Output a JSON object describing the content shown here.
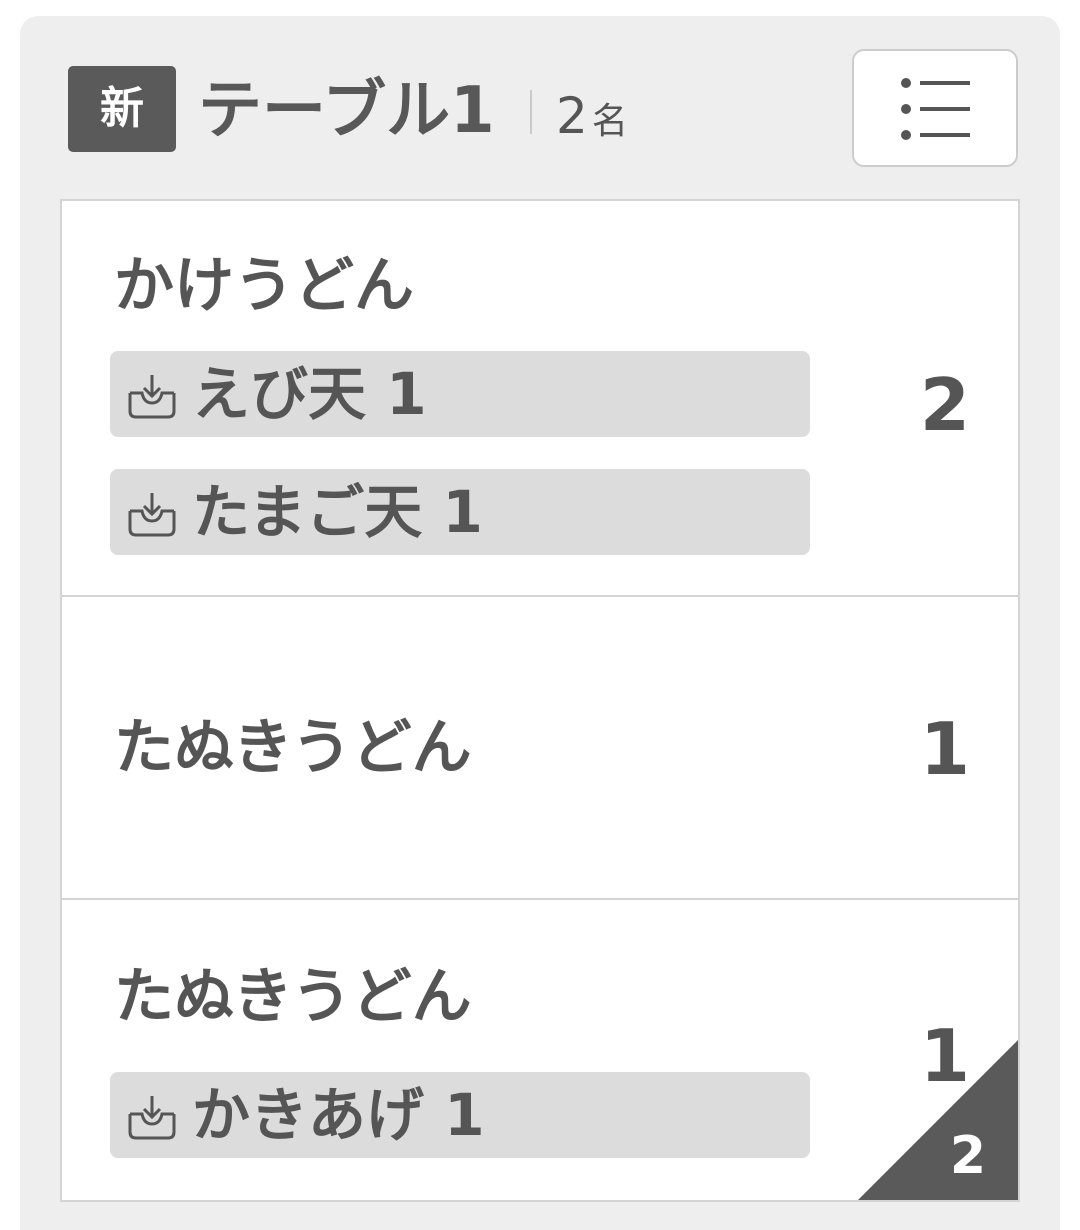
{
  "header": {
    "new_badge": "新",
    "table_name": "テーブル1",
    "guest_count": "2",
    "guest_unit": "名",
    "menu_icon": "list-icon"
  },
  "orders": [
    {
      "name": "かけうどん",
      "quantity": "2",
      "toppings": [
        {
          "icon": "takeout-tray-icon",
          "label": "えび天 1"
        },
        {
          "icon": "takeout-tray-icon",
          "label": "たまご天 1"
        }
      ]
    },
    {
      "name": "たぬきうどん",
      "quantity": "1",
      "toppings": []
    },
    {
      "name": "たぬきうどん",
      "quantity": "1",
      "toppings": [
        {
          "icon": "takeout-tray-icon",
          "label": "かきあげ 1"
        }
      ],
      "corner_badge": "2"
    }
  ],
  "colors": {
    "card_bg": "#eeeeee",
    "badge_bg": "#5a5a5a",
    "topping_bg": "#dcdcdc",
    "text": "#555555"
  }
}
